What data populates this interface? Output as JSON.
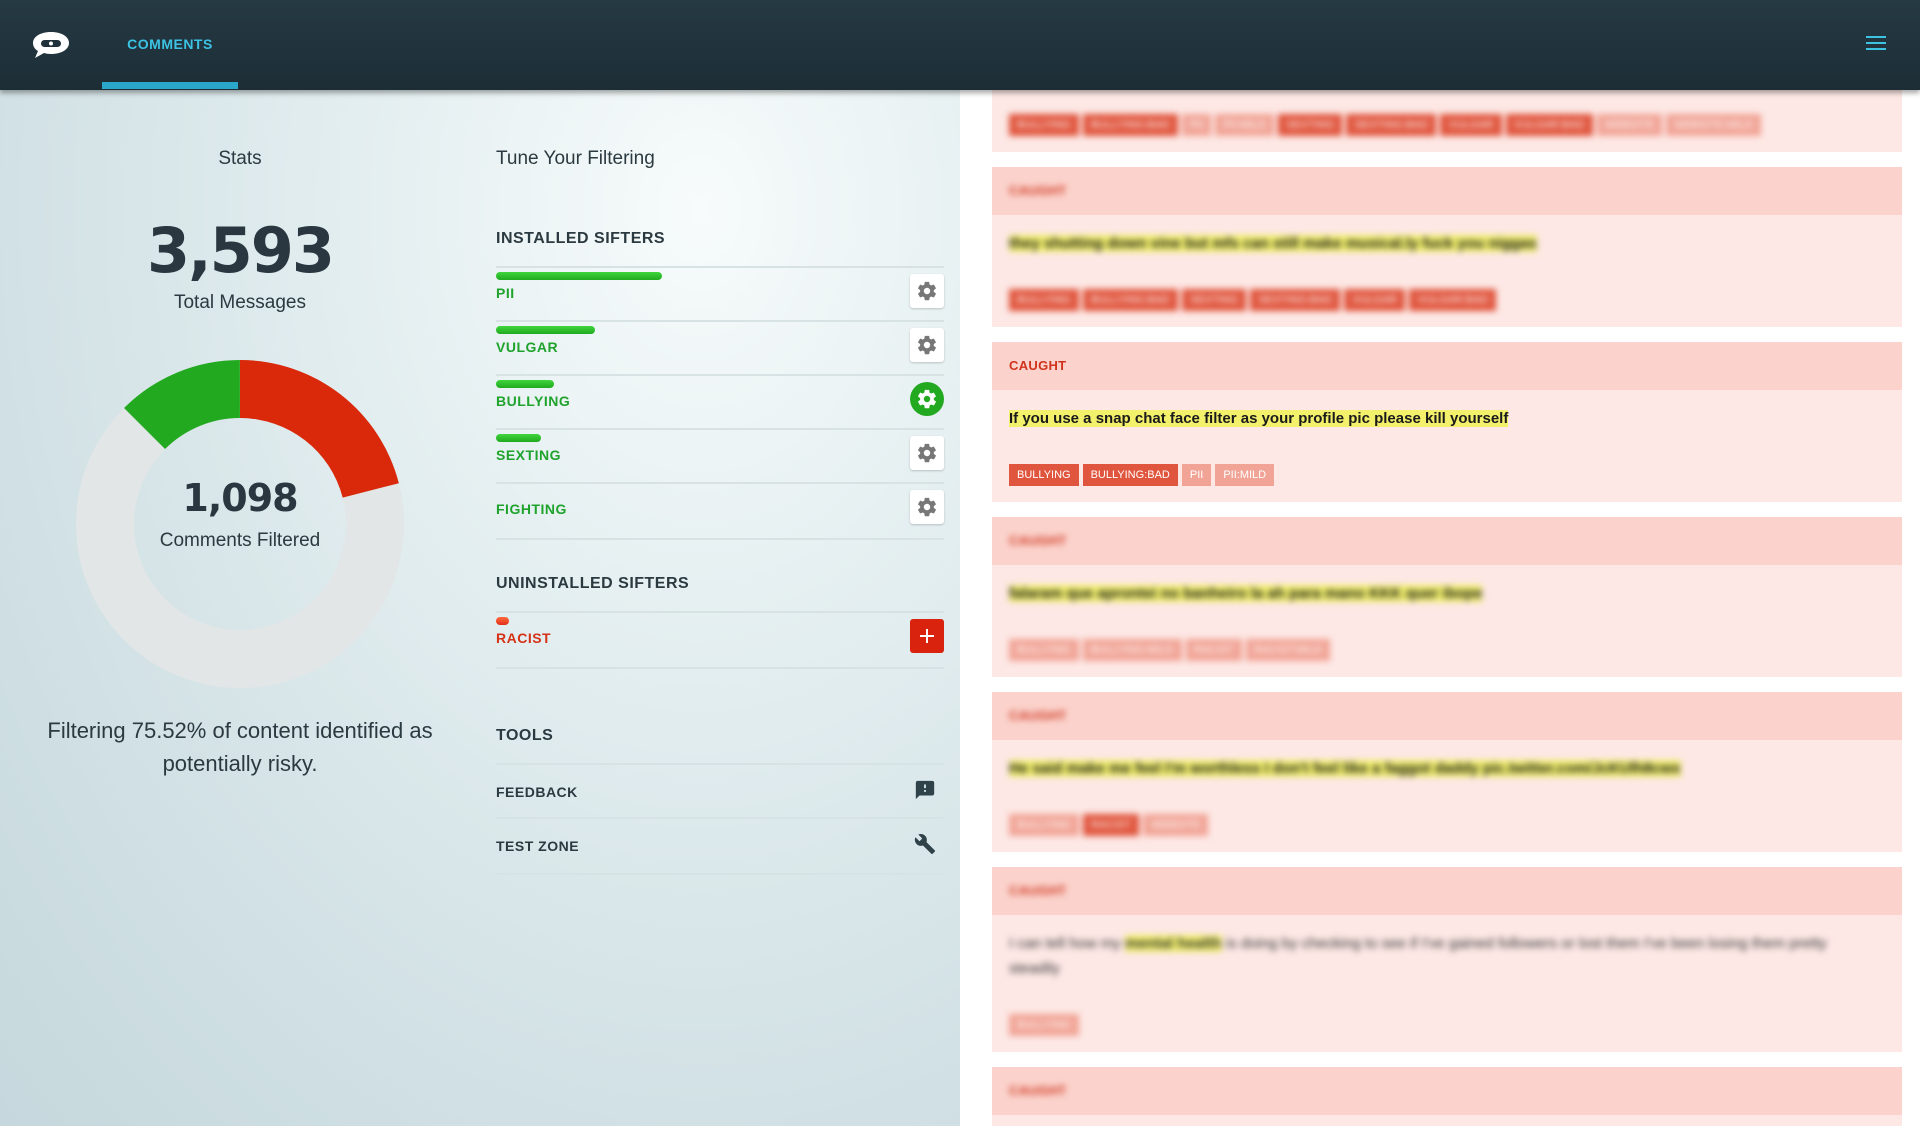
{
  "nav": {
    "logo_icon": "speech-bubble-logo-icon",
    "tab_label": "COMMENTS",
    "menu_icon": "hamburger-menu-icon"
  },
  "stats": {
    "title": "Stats",
    "total_messages": "3,593",
    "total_messages_label": "Total Messages",
    "comments_filtered": "1,098",
    "comments_filtered_label": "Comments Filtered",
    "filter_note": "Filtering 75.52% of content identified as potentially risky.",
    "donut": {
      "colors": {
        "green": "#22a91f",
        "red": "#d9290a",
        "remainder": "#e2e6e7"
      },
      "green_fraction": 0.125,
      "red_fraction": 0.21
    }
  },
  "tune": {
    "title": "Tune Your Filtering",
    "installed_heading": "INSTALLED SIFTERS",
    "installed": [
      {
        "label": "PII",
        "level": 0.37,
        "icon": "gear-icon",
        "active": false
      },
      {
        "label": "VULGAR",
        "level": 0.22,
        "icon": "gear-icon",
        "active": false
      },
      {
        "label": "BULLYING",
        "level": 0.13,
        "icon": "gear-icon",
        "active": true
      },
      {
        "label": "SEXTING",
        "level": 0.1,
        "icon": "gear-icon",
        "active": false
      },
      {
        "label": "FIGHTING",
        "level": 0,
        "icon": "gear-icon",
        "active": false
      }
    ],
    "uninstalled_heading": "UNINSTALLED SIFTERS",
    "uninstalled": [
      {
        "label": "RACIST",
        "level": 0.03,
        "icon": "plus-icon"
      }
    ],
    "tools_heading": "TOOLS",
    "tools": [
      {
        "label": "FEEDBACK",
        "icon": "feedback-icon"
      },
      {
        "label": "TEST ZONE",
        "icon": "wrench-icon"
      }
    ]
  },
  "feed": {
    "status_label": "CAUGHT",
    "comments": [
      {
        "text": "",
        "tags": [
          "BULLYING",
          "BULLYING:BAD",
          "PII",
          "PII:MILD",
          "SEXTING",
          "SEXTING:BAD",
          "VULGAR",
          "VULGAR:BAD",
          "WEBSITE",
          "WEBSITE:MILD"
        ]
      },
      {
        "text": "they shutting down vine but mfs can still make musical.ly fuck you niggas",
        "tags": [
          "BULLYING",
          "BULLYING:BAD",
          "SEXTING",
          "SEXTING:BAD",
          "VULGAR",
          "VULGAR:BAD"
        ]
      },
      {
        "text": "If you use a snap chat face filter as your profile pic please kill yourself",
        "tags": [
          "BULLYING",
          "BULLYING:BAD",
          "PII",
          "PII:MILD"
        ]
      },
      {
        "text": "falaram que aprontei no banheiro la ah para mano KKK quer ibope",
        "tags": [
          "BULLYING",
          "BULLYING:MILD",
          "RACIST",
          "RACIST:MILD"
        ]
      },
      {
        "text": "He said make me feel I'm worthless I don't feel like a faggot daddy pic.twitter.com/JcKUlh8cwx",
        "tags": [
          "BULLYING",
          "RACIST",
          "WEBSITE"
        ]
      },
      {
        "text_before": "I can tell how my ",
        "text_highlight": "mental health",
        "text_after": " is doing by checking to see if I've gained followers or lost them I've been losing them pretty steadily",
        "tags": [
          "BULLYING"
        ]
      },
      {
        "text": "",
        "tags": []
      }
    ]
  }
}
